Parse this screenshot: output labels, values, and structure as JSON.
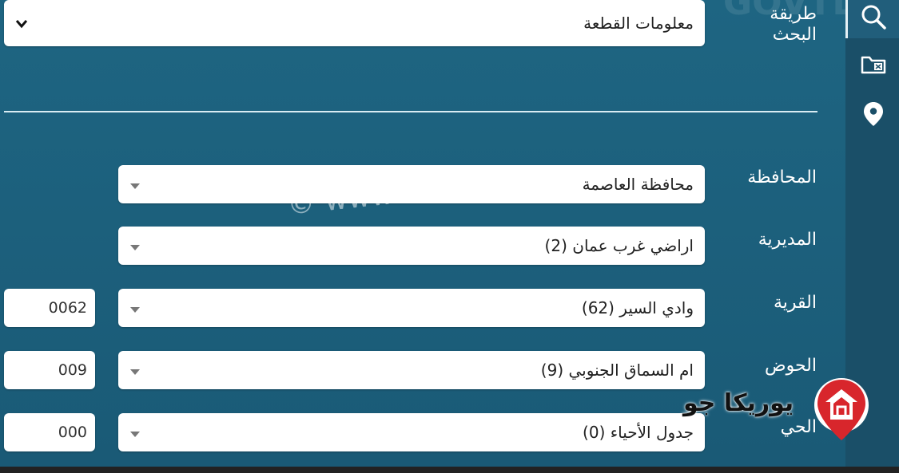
{
  "ghost_text": "GOVTLS",
  "search_method": {
    "label": "طريقة البحث",
    "value": "معلومات القطعة"
  },
  "fields": [
    {
      "label": "المحافظة",
      "value": "محافظة العاصمة"
    },
    {
      "label": "المديرية",
      "value": "اراضي غرب عمان (2)"
    },
    {
      "label": "القرية",
      "value": "وادي السير (62)",
      "code": "0062"
    },
    {
      "label": "الحوض",
      "value": "ام السماق الجنوبي (9)",
      "code": "009"
    },
    {
      "label": "الحي",
      "value": "جدول الأحياء (0)",
      "code": "000"
    }
  ],
  "watermark": "© www.eure....com",
  "logo": {
    "text": "يوريكا جو",
    "accent_color": "#d8262c"
  },
  "colors": {
    "panel": "#1e6582",
    "sidebar": "#1a4f68",
    "input": "#ffffff"
  },
  "sidebar_icons": [
    "search-icon",
    "folder-icon",
    "location-pin-icon"
  ]
}
